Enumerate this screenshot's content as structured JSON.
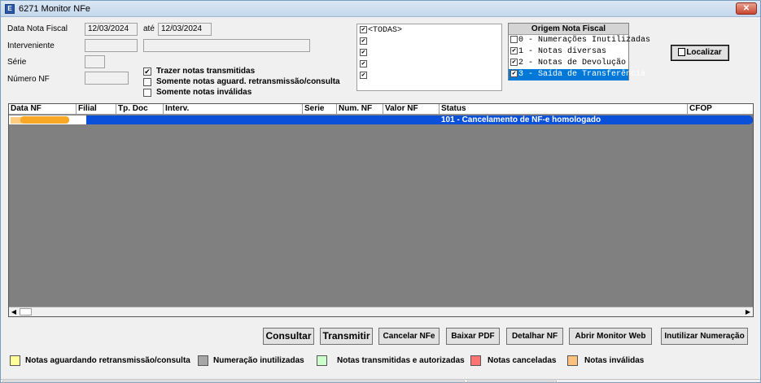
{
  "window": {
    "title": "6271 Monitor NFe",
    "close_symbol": "✕"
  },
  "filters": {
    "data_nota_fiscal_label": "Data Nota Fiscal",
    "date_from": "12/03/2024",
    "ate_label": "até",
    "date_to": "12/03/2024",
    "interveniente_label": "Interveniente",
    "interveniente_code": "",
    "interveniente_name": "",
    "serie_label": "Série",
    "serie_value": "",
    "numero_nf_label": "Número NF",
    "numero_nf_value": "",
    "options": [
      {
        "label": "Trazer notas transmitidas",
        "checked": true
      },
      {
        "label": "Somente notas aguard. retransmissão/consulta",
        "checked": false
      },
      {
        "label": "Somente notas inválidas",
        "checked": false
      }
    ]
  },
  "filial_list": {
    "items": [
      {
        "label": "<TODAS>",
        "checked": true
      },
      {
        "label": "",
        "checked": true
      },
      {
        "label": "",
        "checked": true
      },
      {
        "label": "",
        "checked": true
      },
      {
        "label": "",
        "checked": true
      }
    ]
  },
  "origem": {
    "title": "Origem Nota Fiscal",
    "items": [
      {
        "label": "0 - Numerações Inutilizadas",
        "checked": false,
        "selected": false
      },
      {
        "label": "1 - Notas diversas",
        "checked": true,
        "selected": false
      },
      {
        "label": "2 - Notas de Devolução",
        "checked": true,
        "selected": false
      },
      {
        "label": "3 - Saída de Transferência",
        "checked": true,
        "selected": true
      }
    ]
  },
  "localizar_label": "Localizar",
  "grid": {
    "columns": [
      "Data NF",
      "Filial",
      "Tp. Doc",
      "Interv.",
      "Serie",
      "Num. NF",
      "Valor NF",
      "Status",
      "CFOP"
    ],
    "rows": [
      {
        "data_nf": "",
        "filial": "",
        "tp_doc": "",
        "interv": "",
        "serie": "",
        "num_nf": "",
        "valor_nf": "",
        "status": "101 - Cancelamento de NF-e homologado",
        "cfop": ""
      }
    ]
  },
  "buttons": {
    "consultar": "Consultar",
    "transmitir": "Transmitir",
    "cancelar": "Cancelar NFe",
    "baixar_pdf": "Baixar PDF",
    "detalhar": "Detalhar NF",
    "abrir_monitor": "Abrir Monitor Web",
    "inutilizar": "Inutilizar Numeração"
  },
  "legend": [
    {
      "label": "Notas aguardando retransmissão/consulta",
      "color": "#ffff99"
    },
    {
      "label": "Numeração inutilizadas",
      "color": "#a6a6a6"
    },
    {
      "label": "Notas transmitidas e autorizadas",
      "color": "#ccffcc"
    },
    {
      "label": "Notas canceladas",
      "color": "#ff7373"
    },
    {
      "label": "Notas inválidas",
      "color": "#ffc080"
    }
  ]
}
